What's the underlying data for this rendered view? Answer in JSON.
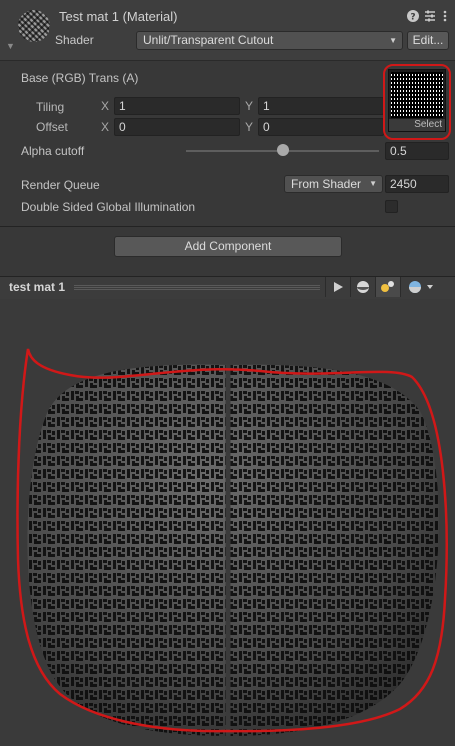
{
  "header": {
    "title": "Test mat 1 (Material)",
    "icons": [
      "help-icon",
      "preset-icon",
      "more-icon"
    ],
    "shader_label": "Shader",
    "shader_value": "Unlit/Transparent Cutout",
    "edit_label": "Edit..."
  },
  "properties": {
    "base_label": "Base (RGB) Trans (A)",
    "tiling_label": "Tiling",
    "offset_label": "Offset",
    "x_label": "X",
    "y_label": "Y",
    "tiling_x": "1",
    "tiling_y": "1",
    "offset_x": "0",
    "offset_y": "0",
    "select_label": "Select",
    "alpha_cutoff_label": "Alpha cutoff",
    "alpha_cutoff_value": "0.5",
    "alpha_cutoff_fraction": 0.5,
    "render_queue_label": "Render Queue",
    "render_queue_mode": "From Shader",
    "render_queue_value": "2450",
    "double_sided_label": "Double Sided Global Illumination",
    "double_sided_checked": false
  },
  "add_component_label": "Add Component",
  "preview": {
    "title": "test mat 1",
    "toolbar_icons": [
      "play-icon",
      "sphere-icon",
      "light-icon",
      "skybox-icon"
    ]
  },
  "colors": {
    "annotation_red": "#d01818",
    "panel_bg": "#383838"
  }
}
